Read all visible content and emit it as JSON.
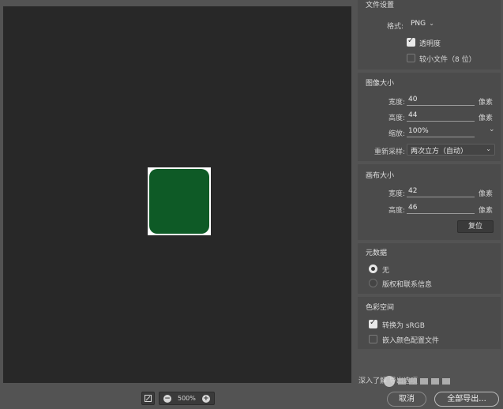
{
  "file_settings": {
    "title": "文件设置",
    "format_label": "格式:",
    "format_value": "PNG",
    "transparency_label": "透明度",
    "transparency_checked": true,
    "smaller_file_label": "较小文件（8 位）",
    "smaller_file_checked": false
  },
  "image_size": {
    "title": "图像大小",
    "width_label": "宽度:",
    "width_value": "40",
    "height_label": "高度:",
    "height_value": "44",
    "scale_label": "缩放:",
    "scale_value": "100%",
    "resample_label": "重新采样:",
    "resample_value": "两次立方（自动）",
    "unit": "像素"
  },
  "canvas_size": {
    "title": "画布大小",
    "width_label": "宽度:",
    "width_value": "42",
    "height_label": "高度:",
    "height_value": "46",
    "unit": "像素",
    "reset_label": "复位"
  },
  "metadata": {
    "title": "元数据",
    "option_none": "无",
    "option_copyright": "版权和联系信息",
    "selected": "none"
  },
  "color_space": {
    "title": "色彩空间",
    "convert_srgb_label": "转换为 sRGB",
    "convert_srgb_checked": true,
    "embed_profile_label": "嵌入颜色配置文件",
    "embed_profile_checked": false
  },
  "preview": {
    "zoom_level": "500%",
    "tile_color": "#0e5a26"
  },
  "footer": {
    "learn_more": "深入了解 导出选项",
    "cancel_label": "取消",
    "export_label": "全部导出..."
  }
}
